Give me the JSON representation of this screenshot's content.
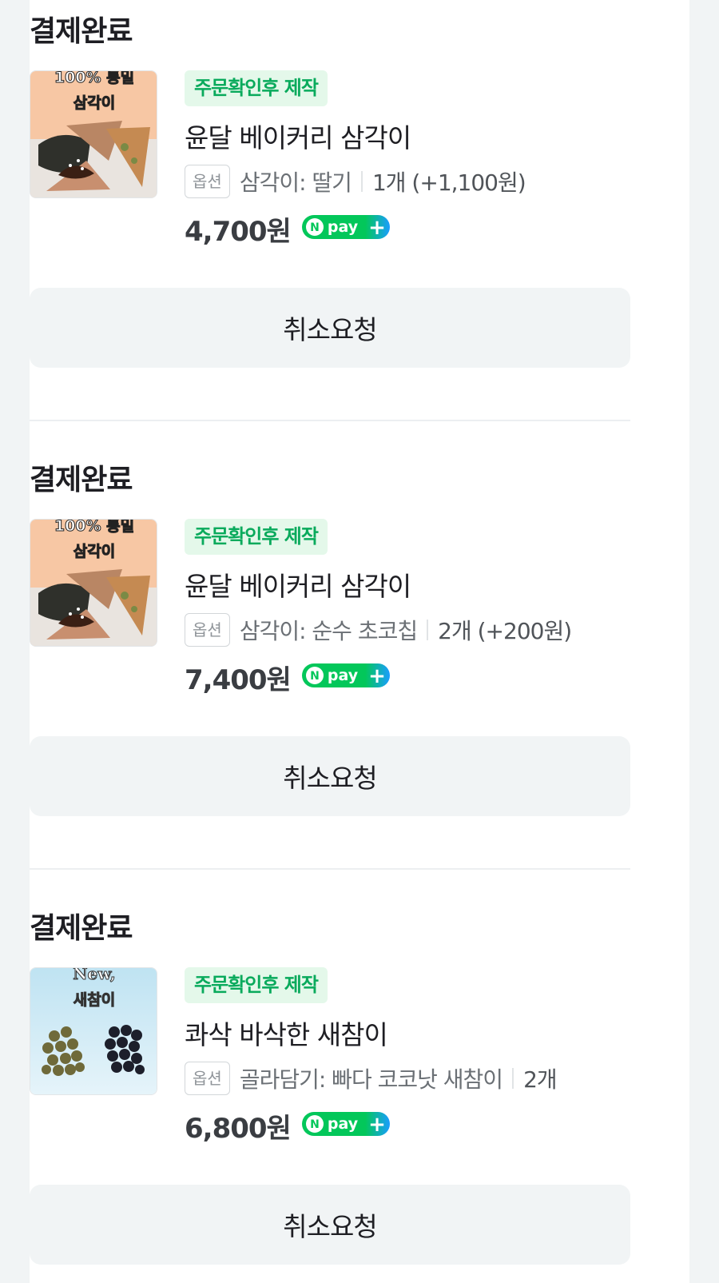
{
  "orders": [
    {
      "status": "결제완료",
      "thumb_text": [
        "100% 통밀",
        "삼각이"
      ],
      "badge": "주문확인후 제작",
      "product_name": "윤달 베이커리 삼각이",
      "option_tag": "옵션",
      "option_text": "삼각이: 딸기",
      "quantity": "1개 (+1,100원)",
      "price": "4,700원",
      "cancel_label": "취소요청"
    },
    {
      "status": "결제완료",
      "thumb_text": [
        "100% 통밀",
        "삼각이"
      ],
      "badge": "주문확인후 제작",
      "product_name": "윤달 베이커리 삼각이",
      "option_tag": "옵션",
      "option_text": "삼각이: 순수 초코칩",
      "quantity": "2개 (+200원)",
      "price": "7,400원",
      "cancel_label": "취소요청"
    },
    {
      "status": "결제완료",
      "thumb_text": [
        "New,",
        "새참이"
      ],
      "badge": "주문확인후 제작",
      "product_name": "콰삭 바삭한 새참이",
      "option_tag": "옵션",
      "option_text": "골라담기: 빠다 코코낫 새참이",
      "quantity": "2개",
      "price": "6,800원",
      "cancel_label": "취소요청"
    }
  ],
  "npay": {
    "n": "N",
    "label": "pay",
    "plus": "+"
  },
  "colors": {
    "accent_green": "#09aa5c",
    "badge_bg": "#e4f8ea",
    "npay_blue": "#1a9dff"
  }
}
